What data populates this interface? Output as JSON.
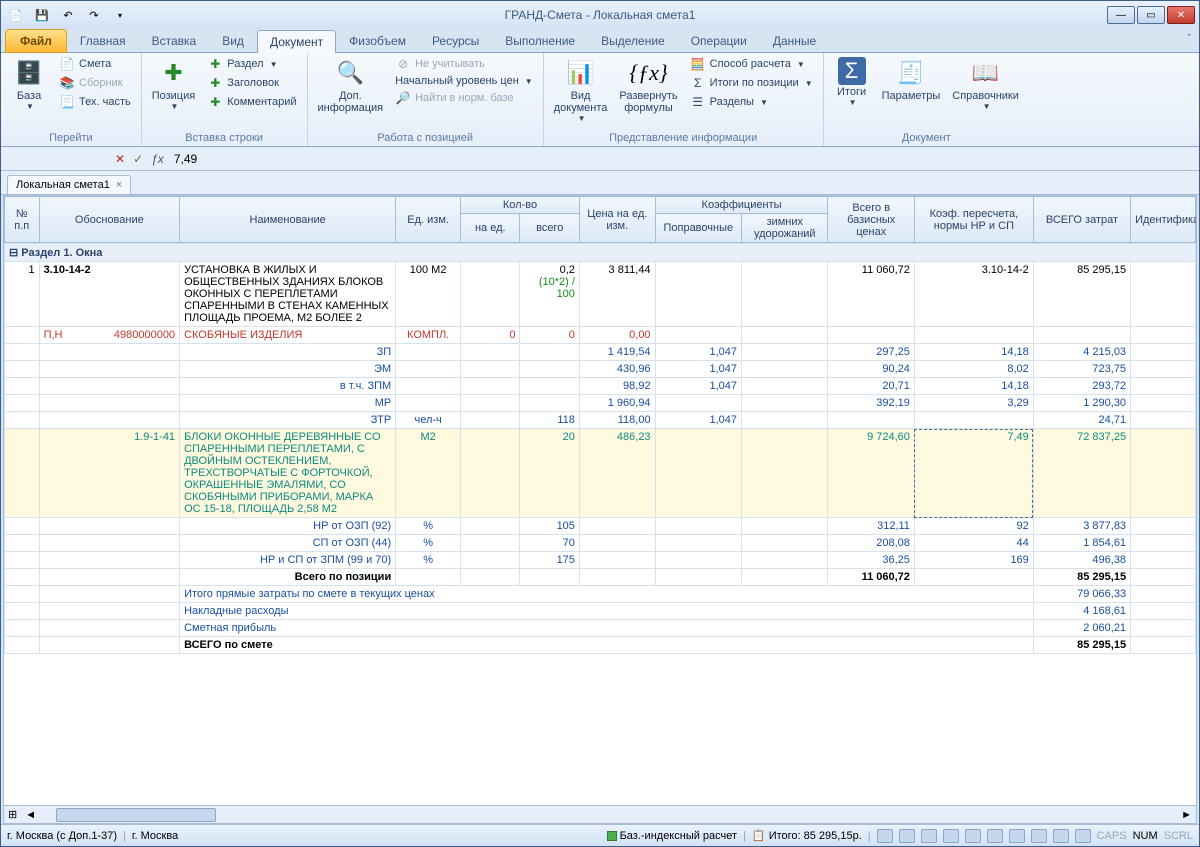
{
  "title": "ГРАНД-Смета - Локальная смета1",
  "ribbon_tabs": {
    "file": "Файл",
    "items": [
      "Главная",
      "Вставка",
      "Вид",
      "Документ",
      "Физобъем",
      "Ресурсы",
      "Выполнение",
      "Выделение",
      "Операции",
      "Данные"
    ],
    "active_index": 3
  },
  "ribbon": {
    "group_goto": {
      "title": "Перейти",
      "base": "База",
      "smeta": "Смета",
      "sbornik": "Сборник",
      "tech": "Тех. часть"
    },
    "group_insert": {
      "title": "Вставка строки",
      "position": "Позиция",
      "razdel": "Раздел",
      "zagolovok": "Заголовок",
      "comment": "Комментарий"
    },
    "group_work": {
      "title": "Работа с позицией",
      "dopinfo_top": "Доп.",
      "dopinfo_bot": "информация",
      "neuchit": "Не учитывать",
      "level": "Начальный уровень цен",
      "find": "Найти в норм. базе"
    },
    "group_view": {
      "title": "Представление информации",
      "viddoc_top": "Вид",
      "viddoc_bot": "документа",
      "formuly_top": "Развернуть",
      "formuly_bot": "формулы",
      "sposob": "Способ расчета",
      "itogi_pos": "Итоги по позиции",
      "razdely": "Разделы"
    },
    "group_doc": {
      "title": "Документ",
      "itogi": "Итоги",
      "params": "Параметры",
      "sprav": "Справочники"
    }
  },
  "formula_bar": {
    "value": "7,49"
  },
  "doc_tab": "Локальная смета1",
  "headers": {
    "num": "№ п.п",
    "obosn": "Обоснование",
    "naim": "Наименование",
    "ed": "Ед. изм.",
    "kolvo": "Кол-во",
    "na_ed": "на ед.",
    "vsego": "всего",
    "tsena": "Цена на ед. изм.",
    "koef": "Коэффициенты",
    "poprav": "Поправочные",
    "zimn": "зимних удорожаний",
    "vsego_baz": "Всего в базисных ценах",
    "koef_per": "Коэф. пересчета, нормы НР и СП",
    "vsego_zatr": "ВСЕГО затрат",
    "ident": "Идентификатор"
  },
  "section": "Раздел 1. Окна",
  "rows": {
    "r1": {
      "num": "1",
      "obosn": "3.10-14-2",
      "naim": "УСТАНОВКА В ЖИЛЫХ И ОБЩЕСТВЕННЫХ ЗДАНИЯХ БЛОКОВ ОКОННЫХ С ПЕРЕПЛЕТАМИ СПАРЕННЫМИ В СТЕНАХ КАМЕННЫХ ПЛОЩАДЬ ПРОЕМА, М2 БОЛЕЕ 2",
      "ed": "100 М2",
      "vsego": "0,2",
      "formula": "(10*2) / 100",
      "tsena": "3 811,44",
      "baz": "11 060,72",
      "koefp": "3.10-14-2",
      "zatr": "85 295,15"
    },
    "rred": {
      "mark": "П,Н",
      "code": "4980000000",
      "naim": "СКОБЯНЫЕ ИЗДЕЛИЯ",
      "ed": "КОМПЛ.",
      "na_ed": "0",
      "vsego": "0",
      "tsena": "0,00"
    },
    "zp": {
      "naim": "ЗП",
      "tsena": "1 419,54",
      "koef": "1,047",
      "baz": "297,25",
      "kp": "14,18",
      "zatr": "4 215,03"
    },
    "em": {
      "naim": "ЭМ",
      "tsena": "430,96",
      "koef": "1,047",
      "baz": "90,24",
      "kp": "8,02",
      "zatr": "723,75"
    },
    "zpm": {
      "naim": "в т.ч. ЗПМ",
      "tsena": "98,92",
      "koef": "1,047",
      "baz": "20,71",
      "kp": "14,18",
      "zatr": "293,72"
    },
    "mr": {
      "naim": "МР",
      "tsena": "1 960,94",
      "baz": "392,19",
      "kp": "3,29",
      "zatr": "1 290,30"
    },
    "ztr": {
      "naim": "ЗТР",
      "ed": "чел-ч",
      "vsego": "118",
      "tsena": "118,00",
      "koef": "1,047",
      "zatr": "24,71"
    },
    "blk": {
      "obosn": "1.9-1-41",
      "naim": "БЛОКИ ОКОННЫЕ ДЕРЕВЯННЫЕ СО СПАРЕННЫМИ ПЕРЕПЛЕТАМИ, С ДВОЙНЫМ ОСТЕКЛЕНИЕМ, ТРЕХСТВОРЧАТЫЕ С ФОРТОЧКОЙ, ОКРАШЕННЫЕ ЭМАЛЯМИ, СО СКОБЯНЫМИ ПРИБОРАМИ, МАРКА ОС 15-18, ПЛОЩАДЬ 2,58 М2",
      "ed": "М2",
      "vsego": "20",
      "tsena": "486,23",
      "baz": "9 724,60",
      "kp": "7,49",
      "zatr": "72 837,25"
    },
    "nr": {
      "naim": "НР от ОЗП (92)",
      "ed": "%",
      "vsego": "105",
      "baz": "312,11",
      "kp": "92",
      "zatr": "3 877,83"
    },
    "sp": {
      "naim": "СП от ОЗП (44)",
      "ed": "%",
      "vsego": "70",
      "baz": "208,08",
      "kp": "44",
      "zatr": "1 854,61"
    },
    "nrsp": {
      "naim": "НР и СП от ЗПМ (99 и 70)",
      "ed": "%",
      "vsego": "175",
      "baz": "36,25",
      "kp": "169",
      "zatr": "496,38"
    },
    "tpos": {
      "naim": "Всего по позиции",
      "baz": "11 060,72",
      "zatr": "85 295,15"
    },
    "itpr": {
      "naim": "Итого прямые затраты по смете в текущих ценах",
      "zatr": "79 066,33"
    },
    "nakl": {
      "naim": "Накладные расходы",
      "zatr": "4 168,61"
    },
    "smpr": {
      "naim": "Сметная прибыль",
      "zatr": "2 060,21"
    },
    "vssm": {
      "naim": "ВСЕГО по смете",
      "zatr": "85 295,15"
    }
  },
  "status": {
    "loc1": "г. Москва (с Доп.1-37)",
    "loc2": "г. Москва",
    "calc": "Баз.-индексный расчет",
    "total_lbl": "Итого:",
    "total_val": "85 295,15р.",
    "caps": "CAPS",
    "num": "NUM",
    "scrl": "SCRL"
  }
}
